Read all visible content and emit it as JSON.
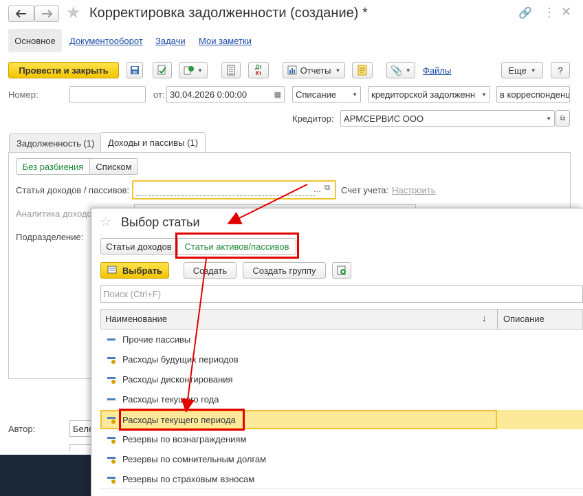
{
  "window": {
    "title": "Корректировка задолженности (создание) *"
  },
  "nav_tabs": [
    "Основное",
    "Документооборот",
    "Задачи",
    "Мои заметки"
  ],
  "toolbar": {
    "post_close": "Провести и закрыть",
    "reports": "Отчеты",
    "files": "Файлы",
    "more": "Еще",
    "help": "?",
    "dtkt": "Дт Кт"
  },
  "form": {
    "number_label": "Номер:",
    "number_value": "",
    "date_label": "от:",
    "date_value": "30.04.2026  0:00:00",
    "op_type": "Списание",
    "debt_type": "кредиторской задолженн",
    "corr": "в корреспонденц",
    "creditor_label": "Кредитор:",
    "creditor_value": "АРМСЕРВИС ООО",
    "tabs": [
      "Задолженность (1)",
      "Доходы и пассивы (1)"
    ],
    "mode_buttons": [
      "Без разбиения",
      "Списком"
    ],
    "article_label": "Статья доходов / пассивов:",
    "account_label": "Счет учета:",
    "account_link": "Настроить",
    "analytics_label": "Аналитика доходо",
    "division_label": "Подразделение:",
    "author_label": "Автор:",
    "author_value": "Беле"
  },
  "dialog": {
    "title": "Выбор статьи",
    "tabs": [
      "Статьи доходов",
      "Статьи активов/пассивов"
    ],
    "select_btn": "Выбрать",
    "create_btn": "Создать",
    "create_group_btn": "Создать группу",
    "search_placeholder": "Поиск (Ctrl+F)",
    "col_name": "Наименование",
    "col_desc": "Описание",
    "sort_arrow": "↓",
    "rows": [
      {
        "name": "Прочие пассивы",
        "icon": "dash"
      },
      {
        "name": "Расходы будущих периодов",
        "icon": "dash-dot"
      },
      {
        "name": "Расходы дисконтирования",
        "icon": "dash-dot"
      },
      {
        "name": "Расходы текущего года",
        "icon": "dash"
      },
      {
        "name": "Расходы текущего периода",
        "icon": "dash-dot",
        "selected": true
      },
      {
        "name": "Резервы по вознаграждениям",
        "icon": "dash-dot"
      },
      {
        "name": "Резервы по сомнительным долгам",
        "icon": "dash-dot"
      },
      {
        "name": "Резервы по страховым взносам",
        "icon": "dash-dot"
      }
    ]
  },
  "colors": {
    "accent_yellow": "#f4c400",
    "highlight_row": "#fde99a",
    "annotation_red": "#e00000",
    "link_blue": "#1a4da8",
    "active_green": "#1c8a3a"
  }
}
